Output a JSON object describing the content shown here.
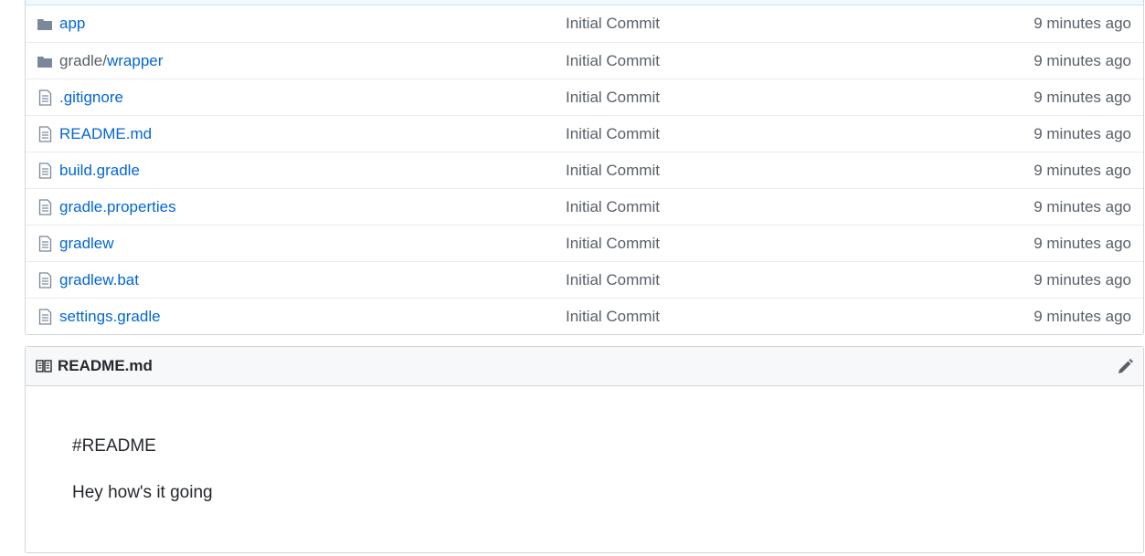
{
  "files": [
    {
      "type": "dir",
      "icon": "folder-icon",
      "name": "app",
      "prefix": "",
      "commit": "Initial Commit",
      "age": "9 minutes ago"
    },
    {
      "type": "dir",
      "icon": "folder-icon",
      "name": "wrapper",
      "prefix": "gradle/",
      "commit": "Initial Commit",
      "age": "9 minutes ago"
    },
    {
      "type": "file",
      "icon": "file-icon",
      "name": ".gitignore",
      "prefix": "",
      "commit": "Initial Commit",
      "age": "9 minutes ago"
    },
    {
      "type": "file",
      "icon": "file-icon",
      "name": "README.md",
      "prefix": "",
      "commit": "Initial Commit",
      "age": "9 minutes ago"
    },
    {
      "type": "file",
      "icon": "file-icon",
      "name": "build.gradle",
      "prefix": "",
      "commit": "Initial Commit",
      "age": "9 minutes ago"
    },
    {
      "type": "file",
      "icon": "file-icon",
      "name": "gradle.properties",
      "prefix": "",
      "commit": "Initial Commit",
      "age": "9 minutes ago"
    },
    {
      "type": "file",
      "icon": "file-icon",
      "name": "gradlew",
      "prefix": "",
      "commit": "Initial Commit",
      "age": "9 minutes ago"
    },
    {
      "type": "file",
      "icon": "file-icon",
      "name": "gradlew.bat",
      "prefix": "",
      "commit": "Initial Commit",
      "age": "9 minutes ago"
    },
    {
      "type": "file",
      "icon": "file-icon",
      "name": "settings.gradle",
      "prefix": "",
      "commit": "Initial Commit",
      "age": "9 minutes ago"
    }
  ],
  "readme": {
    "title": "README.md",
    "header_icon": "book-icon",
    "edit_icon": "pencil-icon",
    "paragraphs": [
      "#README",
      "Hey how's it going"
    ]
  },
  "colors": {
    "link": "#0366d6",
    "muted": "#586069",
    "icon": "#79889a",
    "border": "#d1d5da"
  }
}
